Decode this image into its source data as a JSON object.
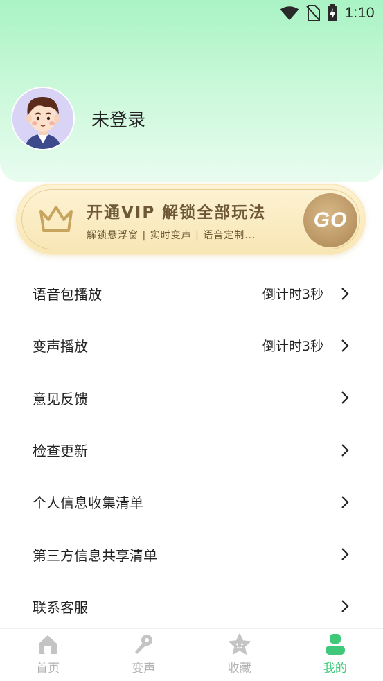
{
  "status_bar": {
    "time": "1:10"
  },
  "profile": {
    "username": "未登录"
  },
  "vip": {
    "title": "开通VIP 解锁全部玩法",
    "subtitle": "解锁悬浮窗 | 实时变声 | 语音定制...",
    "go_label": "GO"
  },
  "menu": {
    "items": [
      {
        "label": "语音包播放",
        "value": "倒计时3秒"
      },
      {
        "label": "变声播放",
        "value": "倒计时3秒"
      },
      {
        "label": "意见反馈",
        "value": ""
      },
      {
        "label": "检查更新",
        "value": ""
      },
      {
        "label": "个人信息收集清单",
        "value": ""
      },
      {
        "label": "第三方信息共享清单",
        "value": ""
      },
      {
        "label": "联系客服",
        "value": ""
      }
    ]
  },
  "tabbar": {
    "tabs": [
      {
        "label": "首页",
        "icon": "home-icon"
      },
      {
        "label": "变声",
        "icon": "microphone-icon"
      },
      {
        "label": "收藏",
        "icon": "star-icon"
      },
      {
        "label": "我的",
        "icon": "user-icon"
      }
    ],
    "active_index": 3
  },
  "colors": {
    "header_gradient_top": "#a9f3c4",
    "accent_green": "#3fc77a",
    "vip_text": "#6e5837",
    "go_button": "#b99463",
    "inactive_tab": "#b3b3b3"
  }
}
